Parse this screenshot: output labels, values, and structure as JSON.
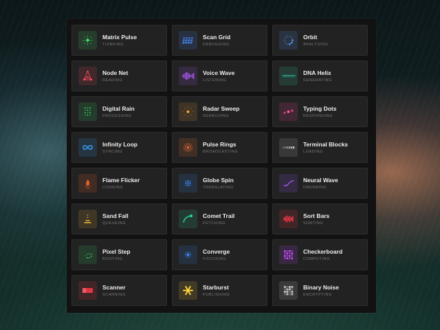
{
  "loaders": [
    {
      "id": "matrix-pulse",
      "title": "Matrix Pulse",
      "status": "THINKING",
      "icon": "matrix-pulse-icon",
      "color": "#3ddc6a"
    },
    {
      "id": "scan-grid",
      "title": "Scan Grid",
      "status": "DEBUGGING",
      "icon": "scan-grid-icon",
      "color": "#4a8dff"
    },
    {
      "id": "orbit",
      "title": "Orbit",
      "status": "ANALYSING",
      "icon": "orbit-icon",
      "color": "#5aa0ff"
    },
    {
      "id": "node-net",
      "title": "Node Net",
      "status": "READING",
      "icon": "node-net-icon",
      "color": "#ff4d5e"
    },
    {
      "id": "voice-wave",
      "title": "Voice Wave",
      "status": "LISTENING",
      "icon": "voice-wave-icon",
      "color": "#b45cff"
    },
    {
      "id": "dna-helix",
      "title": "DNA Helix",
      "status": "GENERATING",
      "icon": "dna-helix-icon",
      "color": "#2fd6b4"
    },
    {
      "id": "digital-rain",
      "title": "Digital Rain",
      "status": "PROCESSING",
      "icon": "digital-rain-icon",
      "color": "#37d46a"
    },
    {
      "id": "radar-sweep",
      "title": "Radar Sweep",
      "status": "SEARCHING",
      "icon": "radar-sweep-icon",
      "color": "#f0a23a"
    },
    {
      "id": "typing-dots",
      "title": "Typing Dots",
      "status": "RESPONDING",
      "icon": "typing-dots-icon",
      "color": "#ff4fa0"
    },
    {
      "id": "infinity-loop",
      "title": "Infinity Loop",
      "status": "SYNCING",
      "icon": "infinity-loop-icon",
      "color": "#3aa0ff"
    },
    {
      "id": "pulse-rings",
      "title": "Pulse Rings",
      "status": "BROADCASTING",
      "icon": "pulse-rings-icon",
      "color": "#ff7a3a"
    },
    {
      "id": "terminal-blocks",
      "title": "Terminal Blocks",
      "status": "LOADING",
      "icon": "terminal-blocks-icon",
      "color": "#bdbdbd"
    },
    {
      "id": "flame-flicker",
      "title": "Flame Flicker",
      "status": "COOKING",
      "icon": "flame-flicker-icon",
      "color": "#ff6a2a"
    },
    {
      "id": "globe-spin",
      "title": "Globe Spin",
      "status": "TRANSLATING",
      "icon": "globe-spin-icon",
      "color": "#3a8dff"
    },
    {
      "id": "neural-wave",
      "title": "Neural Wave",
      "status": "DREAMING",
      "icon": "neural-wave-icon",
      "color": "#a25cff"
    },
    {
      "id": "sand-fall",
      "title": "Sand Fall",
      "status": "QUEUEING",
      "icon": "sand-fall-icon",
      "color": "#f0b23a"
    },
    {
      "id": "comet-trail",
      "title": "Comet Trail",
      "status": "FETCHING",
      "icon": "comet-trail-icon",
      "color": "#2fd6a0"
    },
    {
      "id": "sort-bars",
      "title": "Sort Bars",
      "status": "SORTING",
      "icon": "sort-bars-icon",
      "color": "#ff3a4a"
    },
    {
      "id": "pixel-step",
      "title": "Pixel Step",
      "status": "BOOTING",
      "icon": "pixel-step-icon",
      "color": "#37d46a"
    },
    {
      "id": "converge",
      "title": "Converge",
      "status": "FOCUSING",
      "icon": "converge-icon",
      "color": "#3a8dff"
    },
    {
      "id": "checkerboard",
      "title": "Checkerboard",
      "status": "COMPUTING",
      "icon": "checkerboard-icon",
      "color": "#c84cff"
    },
    {
      "id": "scanner",
      "title": "Scanner",
      "status": "SCANNING",
      "icon": "scanner-icon",
      "color": "#ff3a4a"
    },
    {
      "id": "starburst",
      "title": "Starburst",
      "status": "PUBLISHING",
      "icon": "starburst-icon",
      "color": "#ffd23a"
    },
    {
      "id": "binary-noise",
      "title": "Binary Noise",
      "status": "ENCRYPTING",
      "icon": "binary-noise-icon",
      "color": "#d0d0d0"
    }
  ]
}
